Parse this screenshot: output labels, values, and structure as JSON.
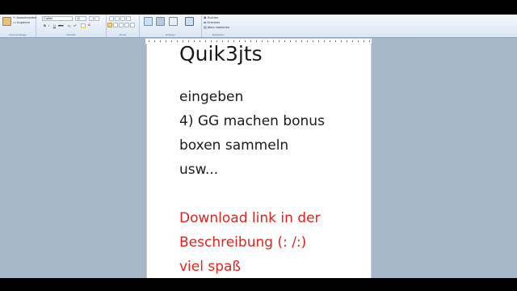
{
  "ribbon": {
    "clipboard": {
      "paste_label": "",
      "cut_label": "Ausschneiden",
      "copy_label": "Kopieren",
      "group_label": "Zwischenablage"
    },
    "font": {
      "font_name": "Calibri",
      "font_size": "11",
      "group_label": "Schriftart"
    },
    "paragraph": {
      "group_label": "Absatz"
    },
    "insert": {
      "group_label": "Einfügen"
    },
    "edit": {
      "find_label": "Suchen",
      "replace_label": "Ersetzen",
      "select_all_label": "Alles markieren",
      "group_label": "Bearbeiten"
    },
    "colors": {
      "bg": "#dbe6f3",
      "accent": "#e2231a"
    }
  },
  "document": {
    "lines": [
      {
        "text": "Quik3jts",
        "style": "big"
      },
      {
        "text": "eingeben",
        "style": "black"
      },
      {
        "text": "4) GG machen bonus",
        "style": "black"
      },
      {
        "text": "boxen sammeln",
        "style": "black"
      },
      {
        "text": "usw...",
        "style": "black"
      },
      {
        "text": "",
        "style": "blank"
      },
      {
        "text": "Download link in der",
        "style": "red"
      },
      {
        "text": "Beschreibung (: /:)",
        "style": "red"
      },
      {
        "text": "viel spaß",
        "style": "red"
      }
    ],
    "colors": {
      "text": "#1a1a1a",
      "red_text": "#e2231a"
    }
  }
}
